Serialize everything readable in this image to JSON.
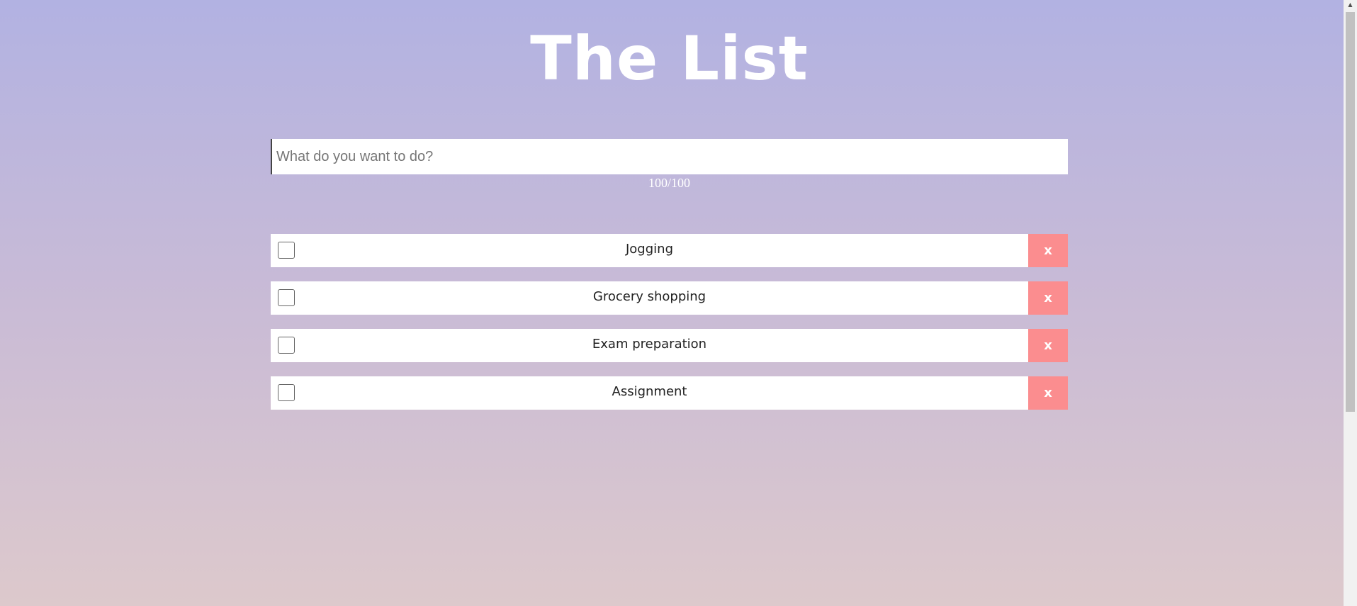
{
  "app": {
    "title": "The List"
  },
  "input": {
    "placeholder": "What do you want to do?",
    "value": "",
    "counter": "100/100"
  },
  "todos": [
    {
      "label": "Jogging",
      "checked": false,
      "delete_label": "x"
    },
    {
      "label": "Grocery shopping",
      "checked": false,
      "delete_label": "x"
    },
    {
      "label": "Exam preparation",
      "checked": false,
      "delete_label": "x"
    },
    {
      "label": "Assignment",
      "checked": false,
      "delete_label": "x"
    }
  ],
  "scrollbar": {
    "up_arrow_icon": "chevron-up-icon"
  },
  "colors": {
    "background_top": "#b2b2e2",
    "background_bottom": "#ddc9cc",
    "delete_button": "#fb8d8f",
    "title": "#ffffff"
  }
}
